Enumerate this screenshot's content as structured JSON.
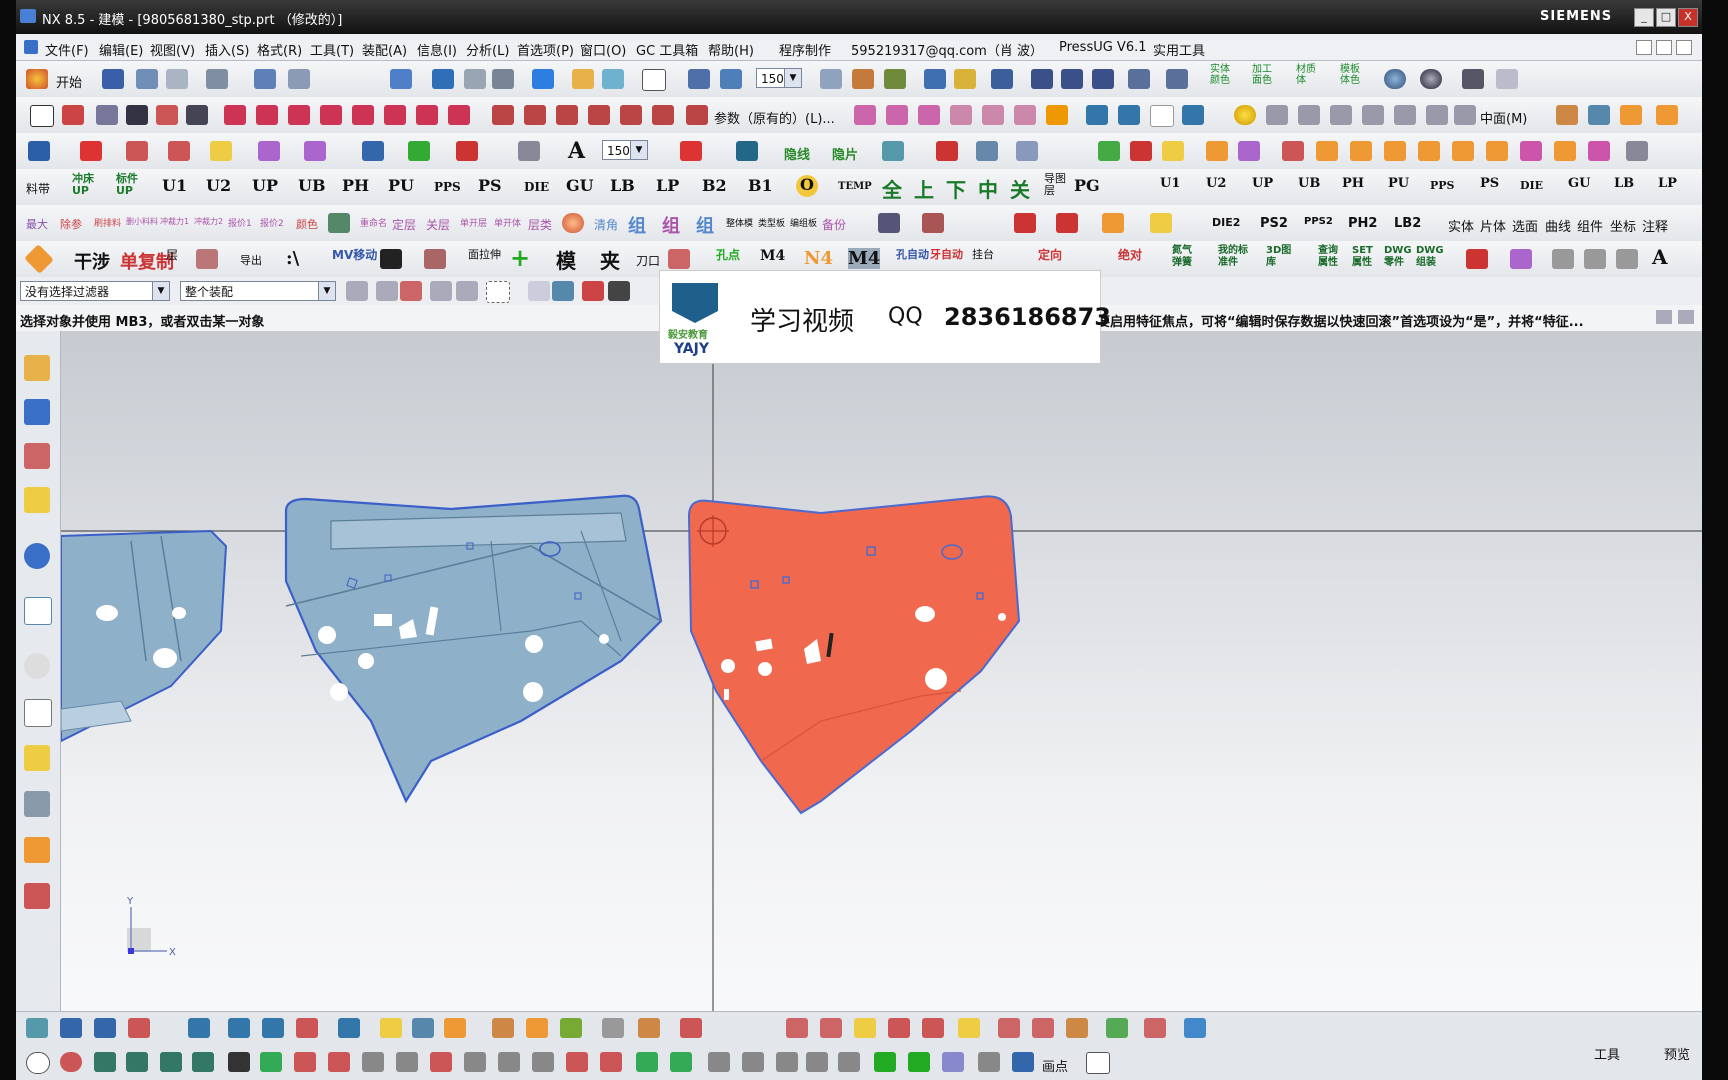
{
  "window": {
    "title": "NX 8.5 - 建模 - [9805681380_stp.prt （修改的）]",
    "brand": "SIEMENS",
    "buttons": [
      "_",
      "□",
      "X"
    ]
  },
  "menubar": {
    "items": [
      "文件(F)",
      "编辑(E)",
      "视图(V)",
      "插入(S)",
      "格式(R)",
      "工具(T)",
      "装配(A)",
      "信息(I)",
      "分析(L)",
      "首选项(P)",
      "窗口(O)",
      "GC 工具箱",
      "帮助(H)",
      "程序制作",
      "595219317@qq.com（肖 波）",
      "PressUG V6.1",
      "实用工具"
    ]
  },
  "toolbar1": {
    "start_label": "开始",
    "zoom_value": "150",
    "right_labels": [
      "实体颜色",
      "加工面色",
      "材质体",
      "模板体色"
    ]
  },
  "toolbar2": {
    "params_label": "参数（原有的）(L)...",
    "plane_label": "中面(M)"
  },
  "toolbar3": {
    "zoom_value": "150",
    "text_icon": "A",
    "labels": [
      "隐线",
      "隐片"
    ]
  },
  "toolbar4": {
    "labels": [
      "料带",
      "冲床UP",
      "标件UP",
      "U1",
      "U2",
      "UP",
      "UB",
      "PH",
      "PU",
      "PPS",
      "PS",
      "DIE",
      "GU",
      "LB",
      "LP",
      "B2",
      "B1",
      "O",
      "TEMP",
      "全",
      "上",
      "下",
      "中",
      "关",
      "导图层",
      "PG"
    ],
    "right_labels": [
      "U1",
      "U2",
      "UP",
      "UB",
      "PH",
      "PU",
      "PPS",
      "PS",
      "DIE",
      "GU",
      "LB",
      "LP"
    ]
  },
  "toolbar5": {
    "labels": [
      "最大",
      "除参",
      "刷排料",
      "删小料料",
      "冲裁力1",
      "冲裁力2",
      "报价1",
      "报价2",
      "颜色",
      "重命名",
      "定层",
      "关层",
      "单开层",
      "单开体",
      "层类",
      "清角",
      "组",
      "组",
      "组",
      "整体模",
      "类型板",
      "编组板",
      "备份"
    ],
    "right_labels": [
      "DIE2",
      "PS2",
      "PPS2",
      "PH2",
      "LB2",
      "实体",
      "片体",
      "选面",
      "曲线",
      "组件",
      "坐标",
      "注释"
    ]
  },
  "toolbar6": {
    "labels": [
      "干涉",
      "单复制",
      "层",
      "导出",
      ":\\",
      "MV移动",
      "面拉伸",
      "模",
      "夹",
      "刀口",
      "孔点",
      "M4",
      "N4",
      "M4",
      "孔自动",
      "牙自动",
      "挂台",
      "定向",
      "绝对",
      "氮气弹簧",
      "我的标准件",
      "3D图库",
      "查询属性",
      "SET属性",
      "DWG零件",
      "DWG组装",
      "A"
    ]
  },
  "filterbar": {
    "filter_value": "没有选择过滤器",
    "scope_value": "整个装配"
  },
  "status": {
    "prompt": "选择对象并使用 MB3，或者双击某一对象",
    "hint": "。要启用特征焦点，可将“编辑时保存数据以快速回滚”首选项设为“是”，并将“特征..."
  },
  "overlay": {
    "logo_cn": "毅安教育",
    "logo_en": "YAJY",
    "label": "学习视频",
    "qq_label": "QQ",
    "qq_number": "2836186873"
  },
  "viewport": {
    "triad_y": "Y",
    "triad_x": "X",
    "colors": {
      "part_blue": "#8fb0c9",
      "part_blue_edge": "#3a5fc8",
      "part_red": "#f0684d",
      "part_red_edge": "#4a6ad0"
    }
  },
  "bottom": {
    "tools_label": "工具",
    "preview_label": "预览",
    "point_label": "画点"
  }
}
